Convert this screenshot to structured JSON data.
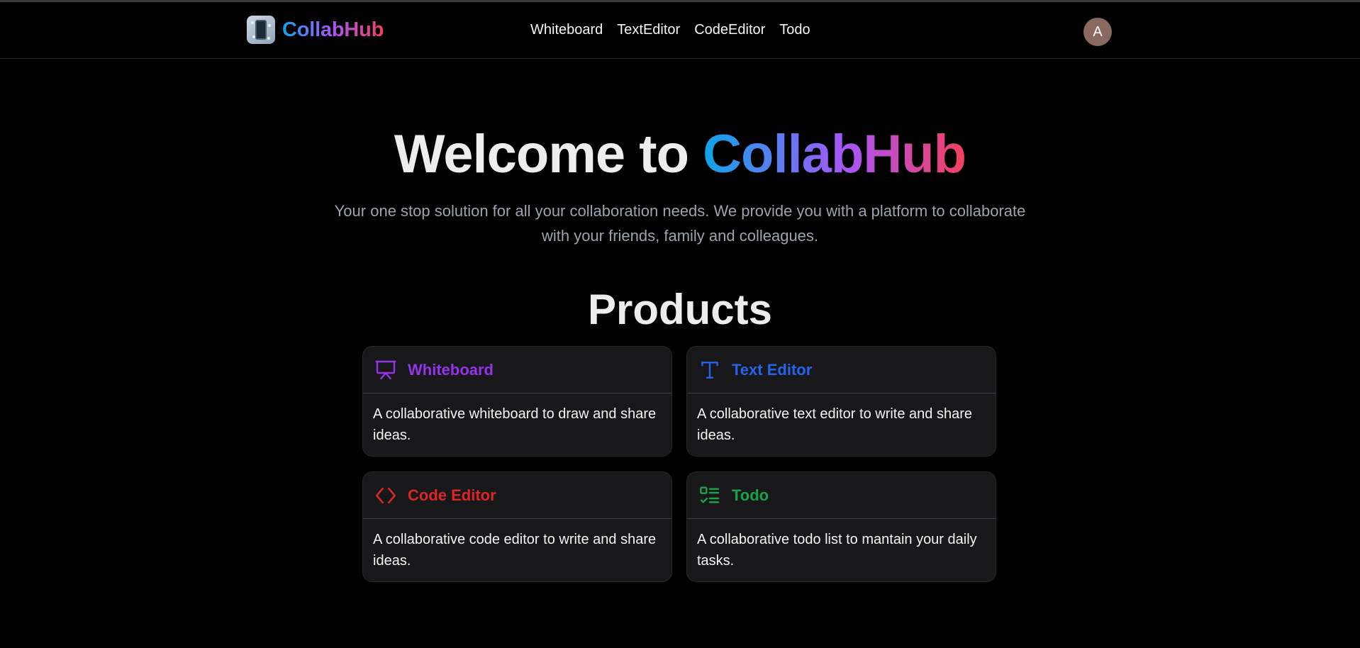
{
  "header": {
    "brand": "CollabHub",
    "nav": [
      "Whiteboard",
      "TextEditor",
      "CodeEditor",
      "Todo"
    ],
    "avatar_initial": "A"
  },
  "hero": {
    "title_prefix": "Welcome to ",
    "title_brand": "CollabHub",
    "subtitle": "Your one stop solution for all your collaboration needs. We provide you with a platform to collaborate with your friends, family and colleagues."
  },
  "products": {
    "heading": "Products",
    "items": [
      {
        "title": "Whiteboard",
        "description": "A collaborative whiteboard to draw and share ideas.",
        "icon": "presentation-board-icon",
        "color": "#9333ea"
      },
      {
        "title": "Text Editor",
        "description": "A collaborative text editor to write and share ideas.",
        "icon": "text-type-icon",
        "color": "#2563eb"
      },
      {
        "title": "Code Editor",
        "description": "A collaborative code editor to write and share ideas.",
        "icon": "code-brackets-icon",
        "color": "#dc2626"
      },
      {
        "title": "Todo",
        "description": "A collaborative todo list to mantain your daily tasks.",
        "icon": "checklist-icon",
        "color": "#16a34a"
      }
    ]
  },
  "colors": {
    "background": "#000000",
    "card": "#18181b",
    "gradient_start": "#0ea5e9",
    "gradient_mid": "#a855f7",
    "gradient_end": "#f43f5e"
  }
}
